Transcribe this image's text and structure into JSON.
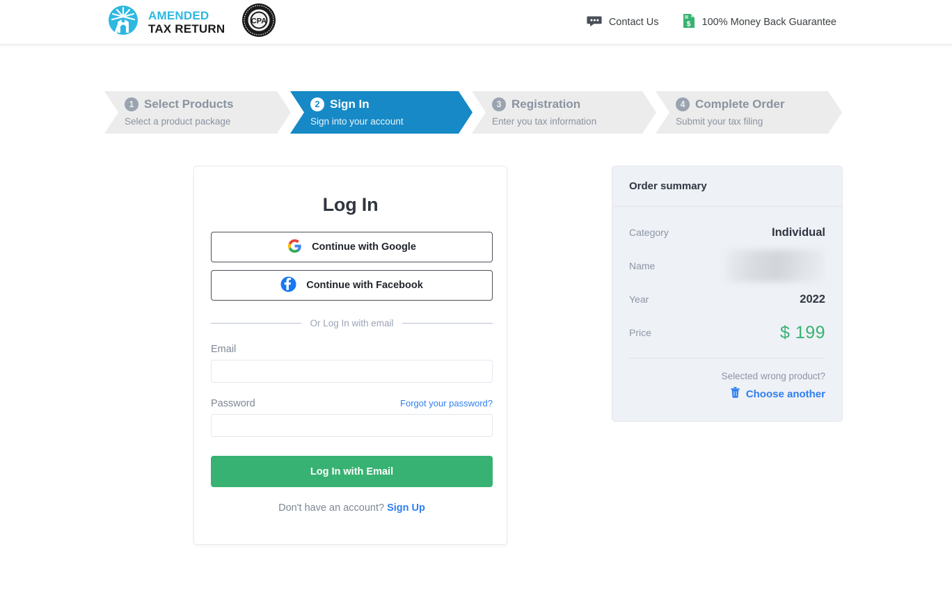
{
  "header": {
    "logo": {
      "line1": "AMENDED",
      "line2": "TAX RETURN",
      "icon": "statue-of-liberty-icon",
      "seal_text": "CPA",
      "seal_ring_top": "CERTIFIED PUBLIC ACCOUNTANT",
      "seal_ring_bottom": "CERTIFIED PUBLIC"
    },
    "links": [
      {
        "label": "Contact Us",
        "icon": "chat-bubble-icon"
      },
      {
        "label": "100% Money Back Guarantee",
        "icon": "money-document-icon"
      }
    ]
  },
  "stepper": {
    "active_index": 2,
    "steps": [
      {
        "num": "1",
        "title": "Select Products",
        "sub": "Select a product package"
      },
      {
        "num": "2",
        "title": "Sign In",
        "sub": "Sign into your account"
      },
      {
        "num": "3",
        "title": "Registration",
        "sub": "Enter you tax information"
      },
      {
        "num": "4",
        "title": "Complete Order",
        "sub": "Submit your tax filing"
      }
    ]
  },
  "login": {
    "title": "Log In",
    "google_button": "Continue with Google",
    "google_icon": "google-g-icon",
    "facebook_button": "Continue with Facebook",
    "facebook_icon": "facebook-f-icon",
    "divider_text": "Or Log In with email",
    "email_label": "Email",
    "email_value": "",
    "email_placeholder": "",
    "password_label": "Password",
    "password_value": "",
    "password_placeholder": "",
    "forgot_link": "Forgot your password?",
    "submit_label": "Log In with Email",
    "signup_prompt": "Don't have an account?",
    "signup_link": "Sign Up"
  },
  "order_summary": {
    "title": "Order summary",
    "rows": [
      {
        "key": "Category",
        "value": "Individual",
        "redacted": false
      },
      {
        "key": "Name",
        "value": "",
        "redacted": true
      },
      {
        "key": "Year",
        "value": "2022",
        "redacted": false
      }
    ],
    "price_key": "Price",
    "price_value": "$ 199",
    "footer_question": "Selected wrong product?",
    "footer_action": "Choose another",
    "footer_icon": "trash-icon"
  },
  "colors": {
    "accent_blue": "#1689c6",
    "link_blue": "#2f7ff0",
    "green": "#38b272",
    "logo_cyan": "#2eb8e0",
    "step_inactive_bg": "#ececec",
    "summary_bg": "#eef1f6"
  }
}
